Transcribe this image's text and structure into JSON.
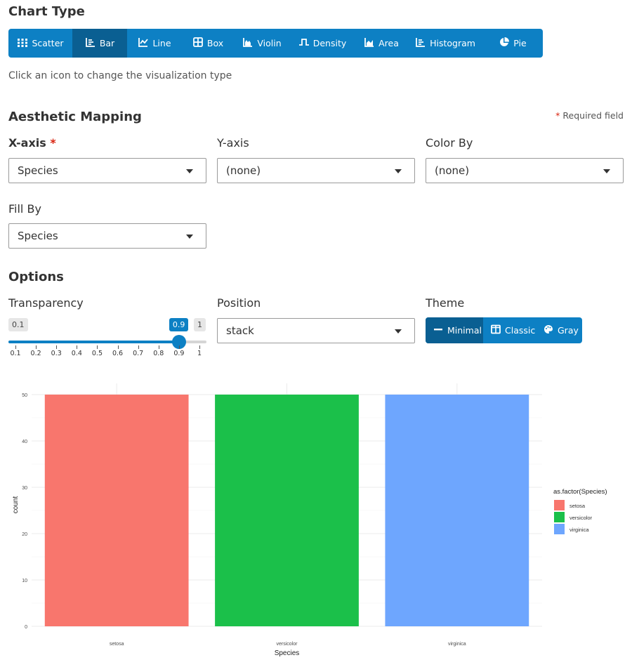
{
  "chart_type": {
    "title": "Chart Type",
    "hint": "Click an icon to change the visualization type",
    "buttons": [
      {
        "label": "Scatter",
        "icon": "scatter-icon",
        "active": false
      },
      {
        "label": "Bar",
        "icon": "bar-chart-icon",
        "active": true
      },
      {
        "label": "Line",
        "icon": "line-chart-icon",
        "active": false
      },
      {
        "label": "Box",
        "icon": "box-plot-icon",
        "active": false
      },
      {
        "label": "Violin",
        "icon": "violin-icon",
        "active": false
      },
      {
        "label": "Density",
        "icon": "density-icon",
        "active": false
      },
      {
        "label": "Area",
        "icon": "area-chart-icon",
        "active": false
      },
      {
        "label": "Histogram",
        "icon": "histogram-icon",
        "active": false
      },
      {
        "label": "Pie",
        "icon": "pie-chart-icon",
        "active": false
      }
    ]
  },
  "aesthetic": {
    "title": "Aesthetic Mapping",
    "required_star": "*",
    "required_note": "Required field",
    "x_label": "X-axis",
    "x_value": "Species",
    "y_label": "Y-axis",
    "y_value": "(none)",
    "color_label": "Color By",
    "color_value": "(none)",
    "fill_label": "Fill By",
    "fill_value": "Species"
  },
  "options": {
    "title": "Options",
    "transparency_label": "Transparency",
    "slider": {
      "min": 0.1,
      "max": 1,
      "value": 0.9,
      "min_badge": "0.1",
      "max_badge": "1",
      "value_badge": "0.9",
      "ticks": [
        "0.1",
        "0.2",
        "0.3",
        "0.4",
        "0.5",
        "0.6",
        "0.7",
        "0.8",
        "0.9",
        "1"
      ]
    },
    "position_label": "Position",
    "position_value": "stack",
    "theme_label": "Theme",
    "themes": [
      {
        "label": "Minimal",
        "icon": "minus-icon",
        "active": true
      },
      {
        "label": "Classic",
        "icon": "columns-icon",
        "active": false
      },
      {
        "label": "Gray",
        "icon": "palette-icon",
        "active": false
      }
    ]
  },
  "chart_data": {
    "type": "bar",
    "categories": [
      "setosa",
      "versicolor",
      "virginica"
    ],
    "values": [
      50,
      50,
      50
    ],
    "colors": [
      "#f8766d",
      "#1bc04a",
      "#6ea6fe"
    ],
    "xlabel": "Species",
    "ylabel": "count",
    "ylim": [
      0,
      50
    ],
    "yticks": [
      0,
      10,
      20,
      30,
      40,
      50
    ],
    "legend": {
      "title": "as.factor(Species)",
      "entries": [
        "setosa",
        "versicolor",
        "virginica"
      ],
      "placement": "right"
    },
    "grid": true
  }
}
